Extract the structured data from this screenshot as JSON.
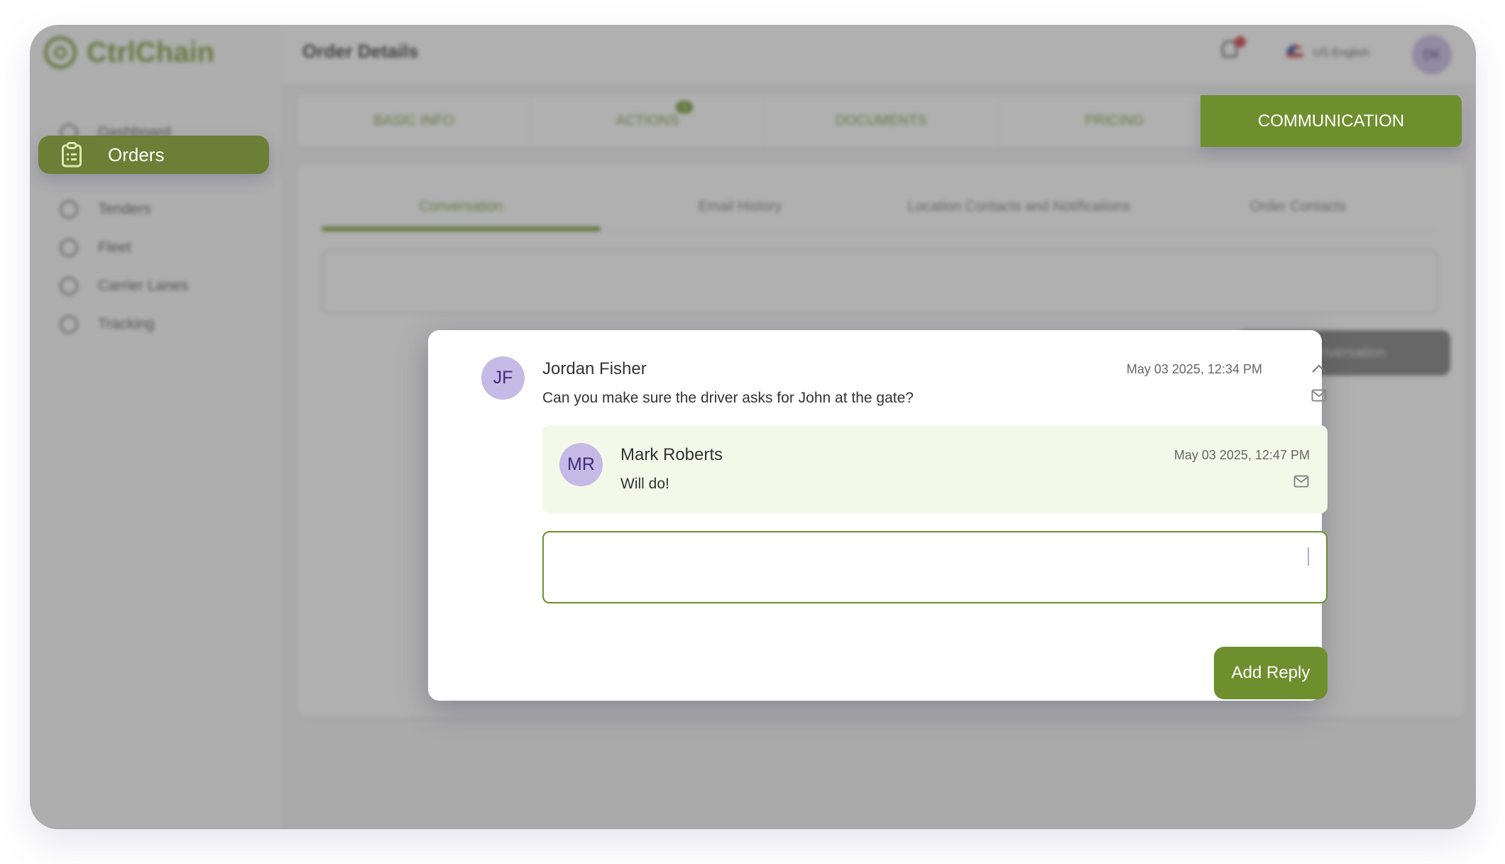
{
  "app": {
    "brand": "CtrlChain",
    "page_title": "Order Details",
    "language": "US English",
    "user_initials": "DK",
    "notification_icon": "bell-icon"
  },
  "sidebar": {
    "items": [
      {
        "label": "Dashboard",
        "icon": "dashboard-icon",
        "active": false
      },
      {
        "label": "Orders",
        "icon": "clipboard-list-icon",
        "active": true
      },
      {
        "label": "Tenders",
        "icon": "tenders-icon",
        "active": false
      },
      {
        "label": "Fleet",
        "icon": "truck-icon",
        "active": false
      },
      {
        "label": "Carrier Lanes",
        "icon": "lanes-icon",
        "active": false
      },
      {
        "label": "Tracking",
        "icon": "location-pin-icon",
        "active": false
      }
    ]
  },
  "main_tabs": [
    {
      "label": "BASIC INFO",
      "active": false
    },
    {
      "label": "ACTIONS",
      "active": false,
      "badge": "1"
    },
    {
      "label": "DOCUMENTS",
      "active": false
    },
    {
      "label": "PRICING",
      "active": false
    },
    {
      "label": "COMMUNICATION",
      "active": true
    }
  ],
  "sub_tabs": [
    {
      "label": "Conversation",
      "active": true
    },
    {
      "label": "Email History",
      "active": false
    },
    {
      "label": "Location Contacts and Notifications",
      "active": false
    },
    {
      "label": "Order Contacts",
      "active": false
    }
  ],
  "background_button_label": "Conversation",
  "thread": {
    "message": {
      "initials": "JF",
      "author": "Jordan Fisher",
      "timestamp": "May 03 2025, 12:34 PM",
      "text": "Can you make sure the driver asks for John at the gate?",
      "collapse_icon": "chevron-up-icon",
      "mail_icon": "mail-icon"
    },
    "reply": {
      "initials": "MR",
      "author": "Mark Roberts",
      "timestamp": "May 03 2025, 12:47 PM",
      "text": "Will do!",
      "mail_icon": "mail-icon"
    },
    "reply_input": {
      "value": "",
      "placeholder": ""
    },
    "add_reply_label": "Add Reply"
  },
  "colors": {
    "brand_green": "#6f8f2e",
    "sidebar_active": "#6c7f37",
    "avatar_bg": "#c5b9e6",
    "reply_bg": "#f4f8e9"
  }
}
